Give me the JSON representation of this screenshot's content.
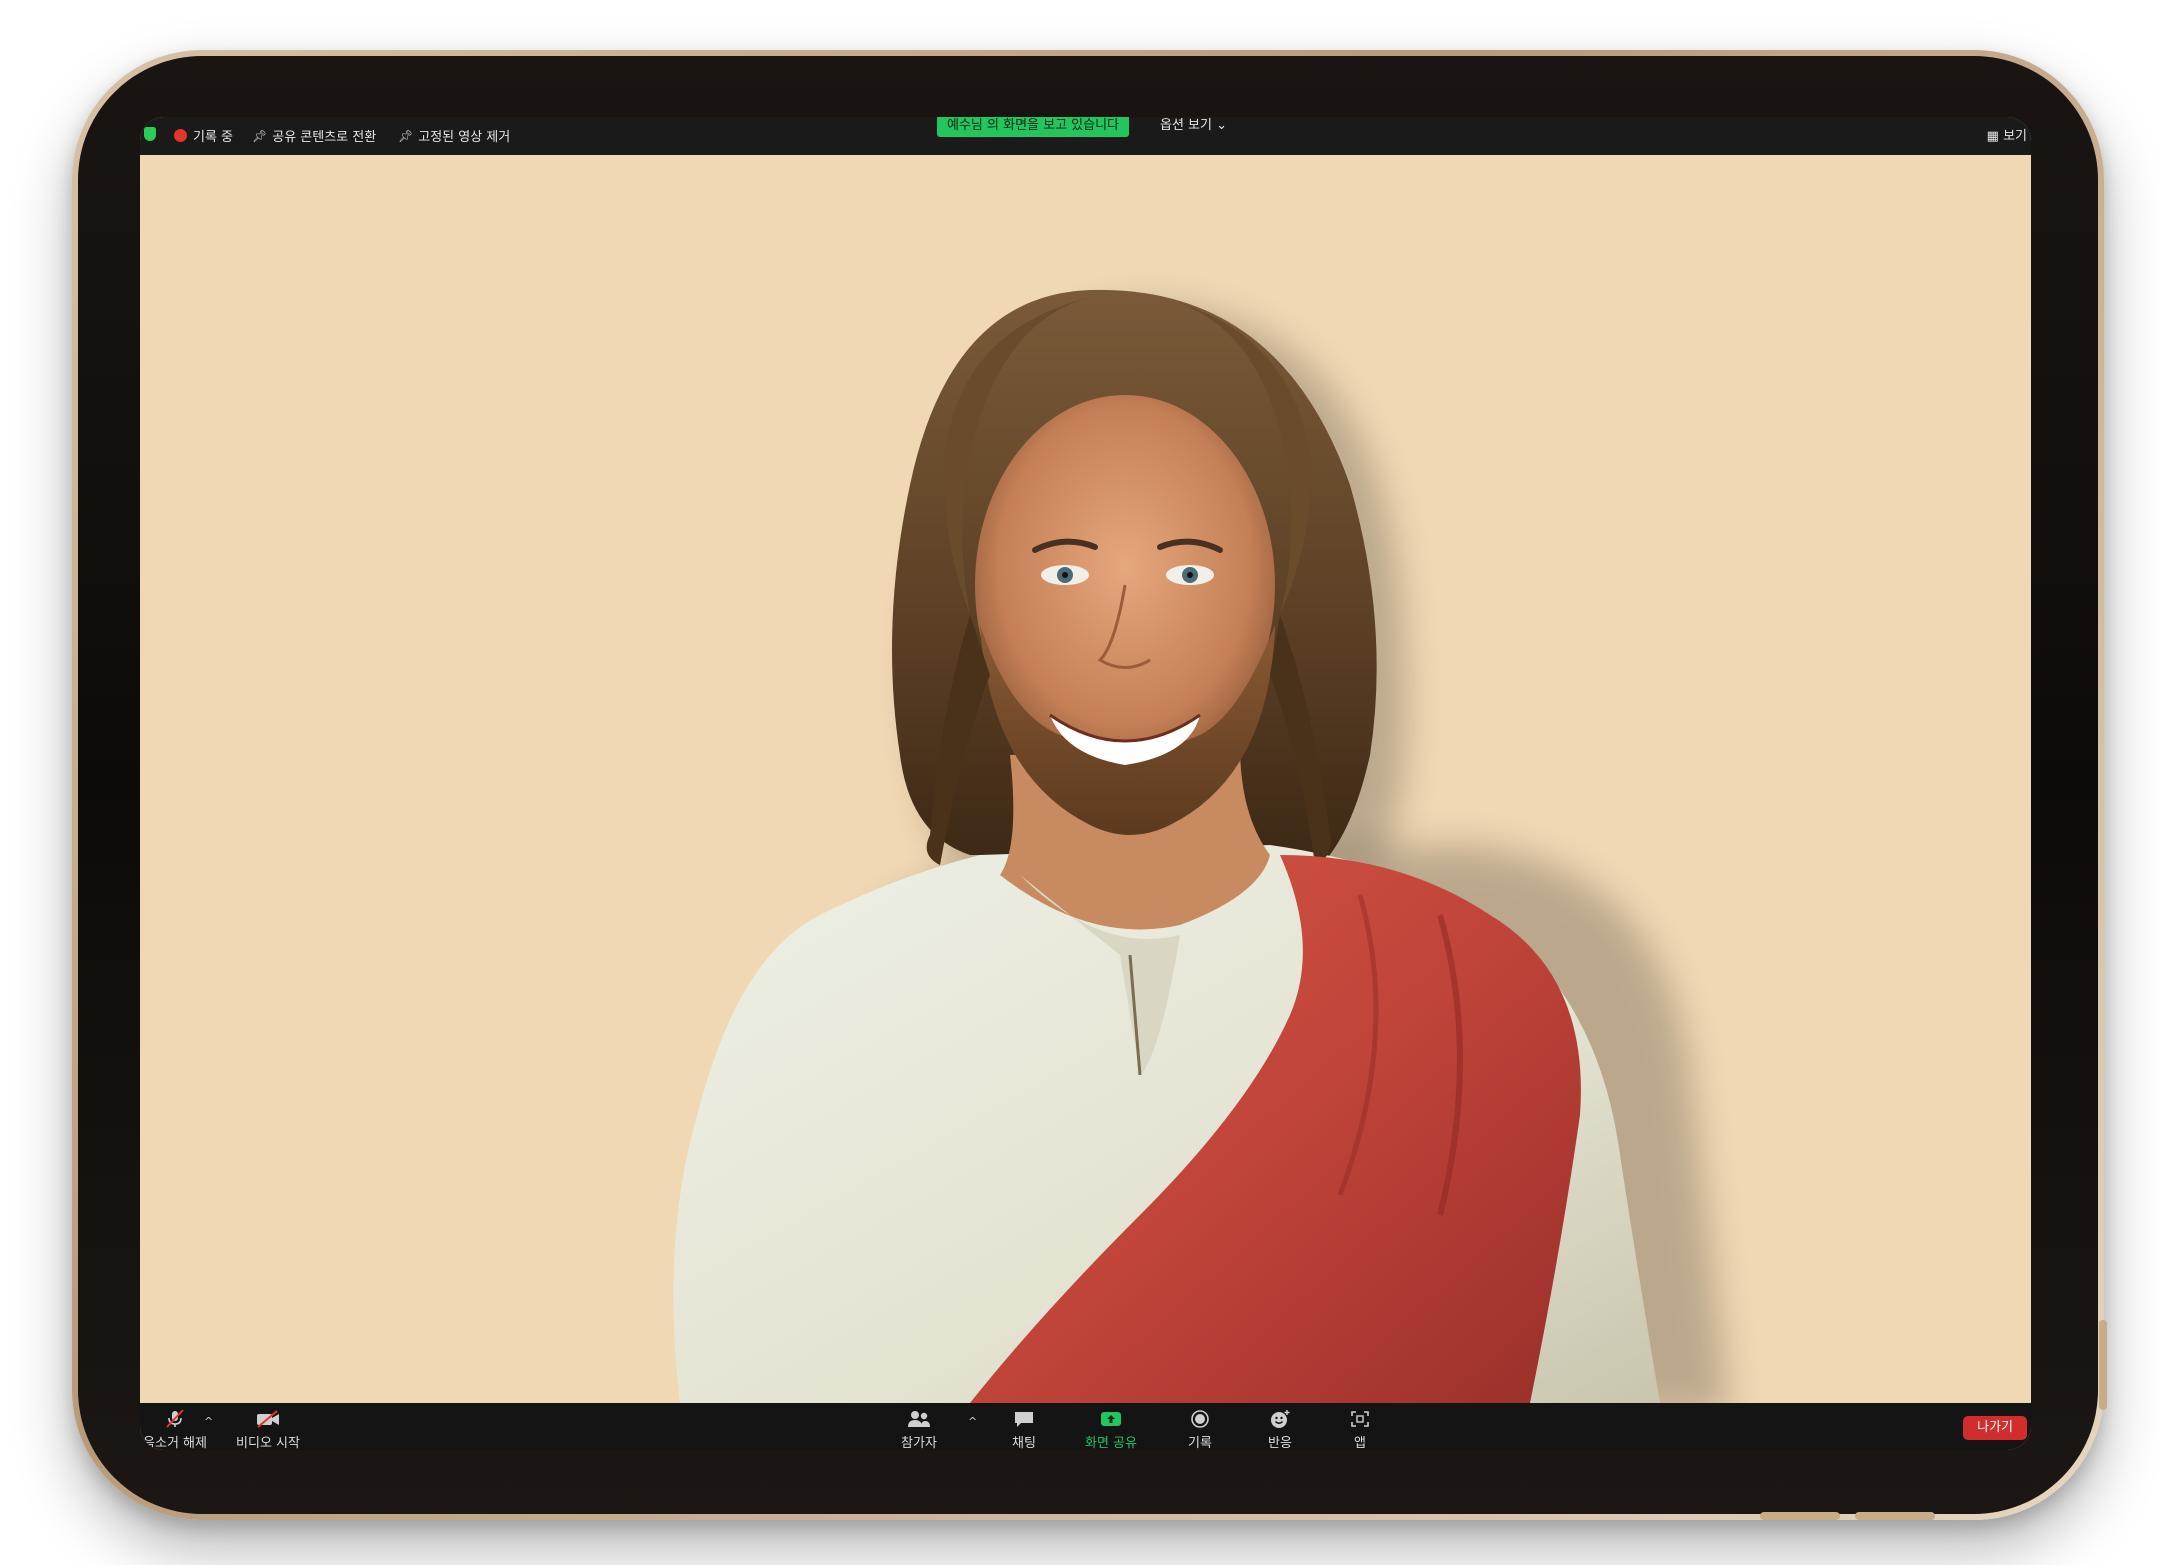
{
  "topbar": {
    "recording_label": "기록 중",
    "switch_shared_label": "공유 콘텐츠로 전환",
    "remove_pin_label": "고정된 영상 제거",
    "viewing_banner": "예수님 의 화면을 보고 있습니다",
    "view_options_label": "옵션 보기",
    "view_options_caret": "⌄",
    "right_label": "보기",
    "colors": {
      "recording_dot": "#e0362b",
      "banner_bg": "#22c55e",
      "bar_bg": "#1a1a1a"
    }
  },
  "video": {
    "background_color": "#f1d8b4",
    "subject": "participant-video"
  },
  "toolbar": {
    "unmute_label": "음소거 해제",
    "start_video_label": "비디오 시작",
    "participants_label": "참가자",
    "chat_label": "채팅",
    "share_screen_label": "화면 공유",
    "record_label": "기록",
    "reactions_label": "반응",
    "apps_label": "앱",
    "leave_label": "나가기",
    "caret": "^",
    "icons": {
      "unmute": "mic-muted-icon",
      "video": "video-off-icon",
      "participants": "participants-icon",
      "chat": "chat-icon",
      "share": "share-screen-icon",
      "record": "record-icon",
      "reactions": "reactions-icon",
      "apps": "apps-icon"
    },
    "colors": {
      "share_accent": "#22c55e",
      "leave_bg": "#d22d2d",
      "bar_bg": "#141414"
    }
  }
}
